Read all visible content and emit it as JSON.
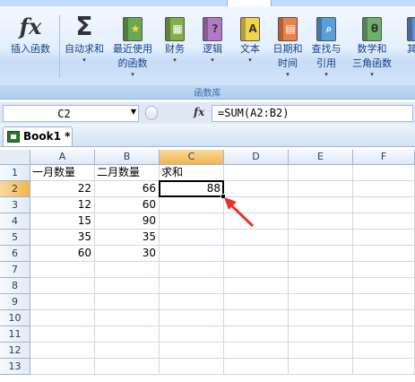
{
  "ribbon": {
    "group_label": "函数库",
    "buttons": [
      {
        "label": "插入函数",
        "label2": "",
        "dropdown": false,
        "icon": "fx-icon"
      },
      {
        "label": "自动求和",
        "label2": "",
        "dropdown": true,
        "icon": "sigma-icon"
      },
      {
        "label": "最近使用",
        "label2": "的函数",
        "dropdown": true,
        "icon": "star-book-icon"
      },
      {
        "label": "财务",
        "label2": "",
        "dropdown": true,
        "icon": "finance-book-icon"
      },
      {
        "label": "逻辑",
        "label2": "",
        "dropdown": true,
        "icon": "logic-book-icon"
      },
      {
        "label": "文本",
        "label2": "",
        "dropdown": true,
        "icon": "text-book-icon"
      },
      {
        "label": "日期和",
        "label2": "时间",
        "dropdown": true,
        "icon": "date-book-icon"
      },
      {
        "label": "查找与",
        "label2": "引用",
        "dropdown": true,
        "icon": "lookup-book-icon"
      },
      {
        "label": "数学和",
        "label2": "三角函数",
        "dropdown": true,
        "icon": "math-book-icon"
      },
      {
        "label": "其他",
        "label2": "",
        "dropdown": true,
        "icon": "more-book-icon"
      }
    ]
  },
  "formula_bar": {
    "name_box": "C2",
    "fx_label": "fx",
    "formula": "=SUM(A2:B2)"
  },
  "workbook": {
    "tab_title": "Book1 *"
  },
  "sheet": {
    "columns": [
      "A",
      "B",
      "C",
      "D",
      "E",
      "F"
    ],
    "rows": [
      "1",
      "2",
      "3",
      "4",
      "5",
      "6",
      "7",
      "8",
      "9",
      "10",
      "11",
      "12",
      "13"
    ],
    "active_cell": "C2",
    "cells": {
      "A1": "一月数量",
      "B1": "二月数量",
      "C1": "求和",
      "A2": "22",
      "B2": "66",
      "C2": "88",
      "A3": "12",
      "B3": "60",
      "A4": "15",
      "B4": "90",
      "A5": "35",
      "B5": "35",
      "A6": "60",
      "B6": "30"
    }
  },
  "annotation": {
    "arrow_color": "#e8322b"
  }
}
